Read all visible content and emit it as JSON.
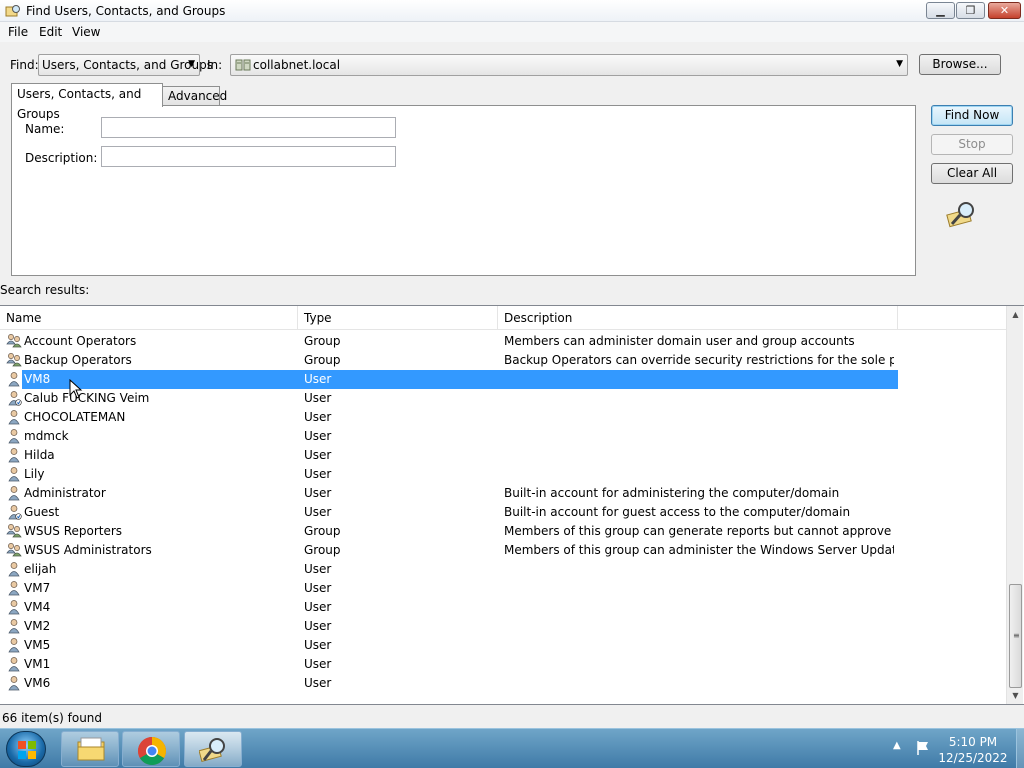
{
  "window": {
    "title": "Find Users, Contacts, and Groups"
  },
  "menu": [
    "File",
    "Edit",
    "View"
  ],
  "find": {
    "find_label": "Find:",
    "find_value": "Users, Contacts, and Groups",
    "in_label": "In:",
    "in_value": "collabnet.local",
    "browse_label": "Browse..."
  },
  "tabs": [
    "Users, Contacts, and Groups",
    "Advanced"
  ],
  "form": {
    "name_label": "Name:",
    "description_label": "Description:",
    "name_value": "",
    "description_value": ""
  },
  "buttons": {
    "find_now": "Find Now",
    "stop": "Stop",
    "clear_all": "Clear All"
  },
  "results": {
    "label": "Search results:",
    "columns": [
      "Name",
      "Type",
      "Description"
    ],
    "rows": [
      {
        "name": "Account Operators",
        "type": "Group",
        "description": "Members can administer domain user and group accounts",
        "icon": "group-icon"
      },
      {
        "name": "Backup Operators",
        "type": "Group",
        "description": "Backup Operators can override security restrictions for the sole purpose ...",
        "icon": "group-icon"
      },
      {
        "name": "VM8",
        "type": "User",
        "description": "",
        "icon": "user-icon",
        "selected": true
      },
      {
        "name": "Calub FUCKING Veim",
        "type": "User",
        "description": "",
        "icon": "user-disabled-icon"
      },
      {
        "name": "CHOCOLATEMAN",
        "type": "User",
        "description": "",
        "icon": "user-icon"
      },
      {
        "name": "mdmck",
        "type": "User",
        "description": "",
        "icon": "user-icon"
      },
      {
        "name": "Hilda",
        "type": "User",
        "description": "",
        "icon": "user-icon"
      },
      {
        "name": "Lily",
        "type": "User",
        "description": "",
        "icon": "user-icon"
      },
      {
        "name": "Administrator",
        "type": "User",
        "description": "Built-in account for administering the computer/domain",
        "icon": "user-icon"
      },
      {
        "name": "Guest",
        "type": "User",
        "description": "Built-in account for guest access to the computer/domain",
        "icon": "user-disabled-icon"
      },
      {
        "name": "WSUS Reporters",
        "type": "Group",
        "description": "Members of this group can generate reports but cannot approve update...",
        "icon": "group-icon"
      },
      {
        "name": "WSUS Administrators",
        "type": "Group",
        "description": "Members of this group can administer the Windows Server Update Servi...",
        "icon": "group-icon"
      },
      {
        "name": "elijah",
        "type": "User",
        "description": "",
        "icon": "user-icon"
      },
      {
        "name": "VM7",
        "type": "User",
        "description": "",
        "icon": "user-icon"
      },
      {
        "name": "VM4",
        "type": "User",
        "description": "",
        "icon": "user-icon"
      },
      {
        "name": "VM2",
        "type": "User",
        "description": "",
        "icon": "user-icon"
      },
      {
        "name": "VM5",
        "type": "User",
        "description": "",
        "icon": "user-icon"
      },
      {
        "name": "VM1",
        "type": "User",
        "description": "",
        "icon": "user-icon"
      },
      {
        "name": "VM6",
        "type": "User",
        "description": "",
        "icon": "user-icon"
      }
    ],
    "status": "66 item(s) found"
  },
  "taskbar": {
    "clock_time": "5:10 PM",
    "clock_date": "12/25/2022",
    "pinned": [
      "windows-explorer-icon",
      "chrome-icon",
      "find-users-icon"
    ]
  },
  "colors": {
    "selection": "#3399ff",
    "taskbar": "#4f88b5"
  }
}
